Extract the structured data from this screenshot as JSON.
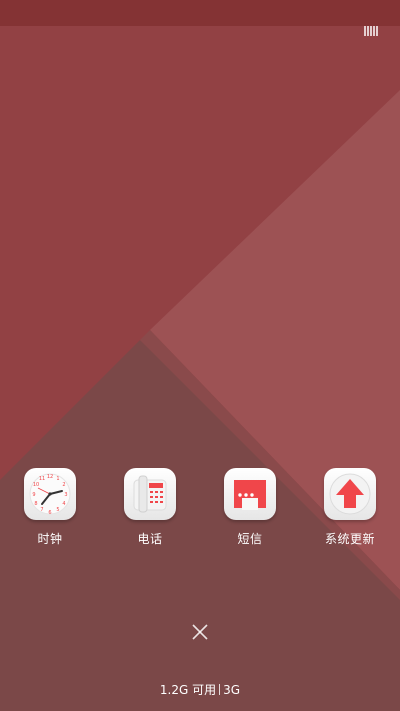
{
  "colors": {
    "wallpaper_top": "#924144",
    "wallpaper_mid": "#9c5153",
    "wallpaper_bottom": "#7b4848",
    "accent_red": "#f0464a",
    "label": "#ffffff"
  },
  "apps": [
    {
      "label": "时钟",
      "icon": "clock-icon"
    },
    {
      "label": "电话",
      "icon": "phone-icon"
    },
    {
      "label": "短信",
      "icon": "message-icon"
    },
    {
      "label": "系统更新",
      "icon": "update-icon"
    }
  ],
  "memory": {
    "available": "1.2G 可用",
    "network": "3G"
  },
  "controls": {
    "close_icon": "close-icon"
  }
}
